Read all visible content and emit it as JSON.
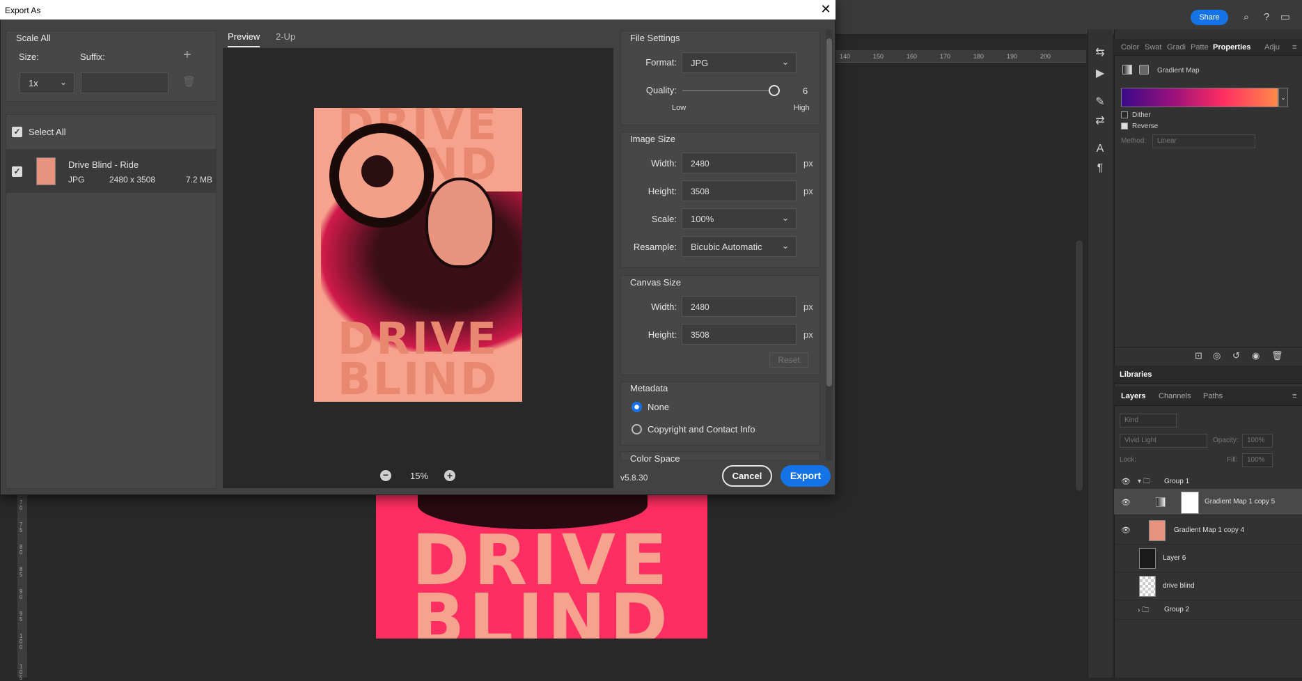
{
  "dialog": {
    "title": "Export As",
    "scale_all": "Scale All",
    "size_label": "Size:",
    "suffix_label": "Suffix:",
    "size_value": "1x",
    "suffix_value": "",
    "select_all": "Select All",
    "file": {
      "name": "Drive Blind - Ride",
      "format": "JPG",
      "dimensions": "2480 x 3508",
      "size": "7.2 MB"
    },
    "tabs": [
      "Preview",
      "2-Up"
    ],
    "zoom": "15%",
    "version": "v5.8.30",
    "cancel": "Cancel",
    "export": "Export"
  },
  "file_settings": {
    "heading": "File Settings",
    "format_label": "Format:",
    "format_value": "JPG",
    "quality_label": "Quality:",
    "quality_value": "6",
    "quality_low": "Low",
    "quality_high": "High"
  },
  "image_size": {
    "heading": "Image Size",
    "width_label": "Width:",
    "width_value": "2480",
    "height_label": "Height:",
    "height_value": "3508",
    "scale_label": "Scale:",
    "scale_value": "100%",
    "resample_label": "Resample:",
    "resample_value": "Bicubic Automatic",
    "unit": "px"
  },
  "canvas_size": {
    "heading": "Canvas Size",
    "width_label": "Width:",
    "width_value": "2480",
    "height_label": "Height:",
    "height_value": "3508",
    "unit": "px",
    "reset": "Reset"
  },
  "metadata": {
    "heading": "Metadata",
    "options": [
      "None",
      "Copyright and Contact Info"
    ],
    "selected": "None"
  },
  "color_space": {
    "heading": "Color Space"
  },
  "artwork": {
    "line1": "DRIVE",
    "line2": "BLIND"
  },
  "photoshop": {
    "share": "Share",
    "ruler_ticks": [
      "140",
      "150",
      "160",
      "170",
      "180",
      "190",
      "200"
    ],
    "vruler_ticks": [
      "7 0",
      "7 5",
      "8 0",
      "8 5",
      "9 0",
      "9 5",
      "1 0 0",
      "1 0 5"
    ],
    "properties": {
      "tabs": [
        "Color",
        "Swat",
        "Gradi",
        "Patte",
        "Properties",
        "Adju"
      ],
      "active_tab": "Properties",
      "layer_type": "Gradient Map",
      "dither": "Dither",
      "reverse": "Reverse",
      "method_label": "Method:",
      "method_value": "Linear"
    },
    "libraries": "Libraries",
    "layers_tabs": [
      "Layers",
      "Channels",
      "Paths"
    ],
    "kind_placeholder": "Kind",
    "blend_mode": "Vivid Light",
    "opacity_label": "Opacity:",
    "opacity_value": "100%",
    "lock_label": "Lock:",
    "fill_label": "Fill:",
    "fill_value": "100%",
    "layers": [
      {
        "name": "Group 1"
      },
      {
        "name": "Gradient Map 1 copy 5"
      },
      {
        "name": "Gradient Map 1 copy 4"
      },
      {
        "name": "Layer 6"
      },
      {
        "name": "drive blind"
      },
      {
        "name": "Group 2"
      }
    ]
  }
}
